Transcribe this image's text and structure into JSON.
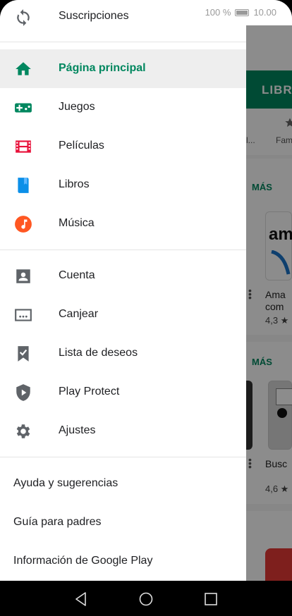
{
  "status_bar": {
    "battery": "100 %",
    "time": "10.00"
  },
  "drawer": {
    "top_item": {
      "label": "Suscripciones",
      "icon": "subscriptions-icon"
    },
    "section_main": [
      {
        "label": "Página principal",
        "icon": "home-icon",
        "selected": true,
        "color": "#01875f"
      },
      {
        "label": "Juegos",
        "icon": "gamepad-icon",
        "color": "#01875f"
      },
      {
        "label": "Películas",
        "icon": "film-icon",
        "color": "#e8113a"
      },
      {
        "label": "Libros",
        "icon": "book-icon",
        "color": "#0b8fe8"
      },
      {
        "label": "Música",
        "icon": "music-icon",
        "color": "#ff5722"
      }
    ],
    "section_account": [
      {
        "label": "Cuenta",
        "icon": "account-icon"
      },
      {
        "label": "Canjear",
        "icon": "redeem-icon"
      },
      {
        "label": "Lista de deseos",
        "icon": "wishlist-icon"
      },
      {
        "label": "Play Protect",
        "icon": "shield-icon"
      },
      {
        "label": "Ajustes",
        "icon": "gear-icon"
      }
    ],
    "section_help": [
      {
        "label": "Ayuda y sugerencias"
      },
      {
        "label": "Guía para padres"
      },
      {
        "label": "Información de Google Play"
      }
    ]
  },
  "background": {
    "tab_label": "LIBR",
    "chip_1": "l...",
    "chip_2": "Fam",
    "more_1": "MÁS",
    "more_2": "MÁS",
    "app1_name_line1": "Ama",
    "app1_name_line2": "com",
    "app1_rating": "4,3 ★",
    "app2_name": "Busc",
    "app2_rating": "4,6 ★",
    "logo_text": "am"
  },
  "colors": {
    "accent": "#01875f",
    "selected_bg": "#eeeeee",
    "text": "#202124",
    "icon_gray": "#5f6368"
  }
}
